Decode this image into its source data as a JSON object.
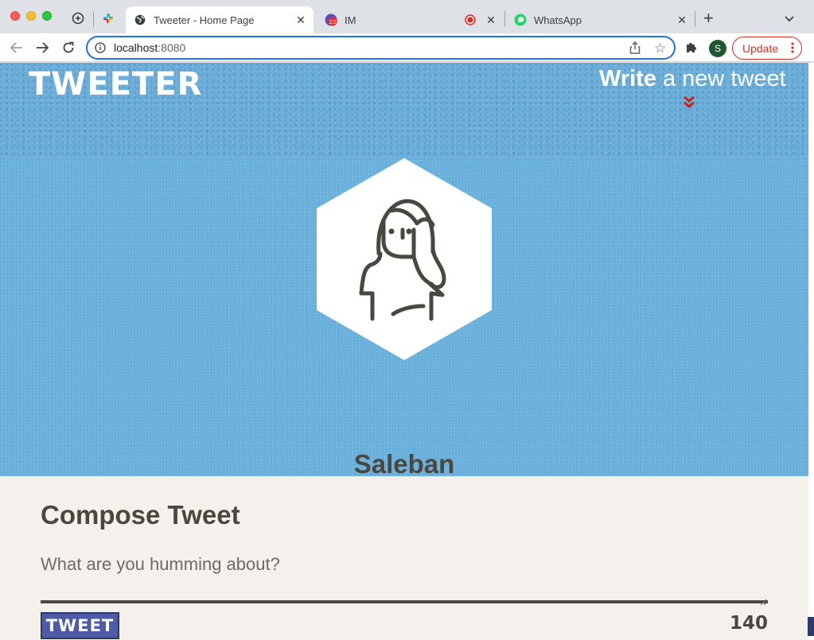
{
  "browser": {
    "tabs": [
      {
        "title": "Tweeter - Home Page",
        "active": true,
        "icon": "globe-icon"
      },
      {
        "title": "IM",
        "active": false,
        "icon": "im-icon",
        "badge": "22"
      },
      {
        "title": "WhatsApp",
        "active": false,
        "icon": "whatsapp-icon"
      }
    ],
    "address": {
      "host": "localhost",
      "port": ":8080"
    },
    "profile_initial": "S",
    "update_label": "Update"
  },
  "app": {
    "logo": "TWEETER",
    "write_cta": {
      "bold": "Write",
      "light": "a new tweet"
    },
    "profile": {
      "username": "Saleban"
    },
    "compose": {
      "title": "Compose Tweet",
      "placeholder": "What are you humming about?",
      "value": "",
      "button_label": "TWEET",
      "counter": "140"
    }
  },
  "colors": {
    "header_blue": "#6aaedb",
    "text_dark": "#4a4640",
    "button_blue": "#4d5ba8",
    "chevron_red": "#cc1f1f",
    "compose_bg": "#f4f1ec"
  }
}
